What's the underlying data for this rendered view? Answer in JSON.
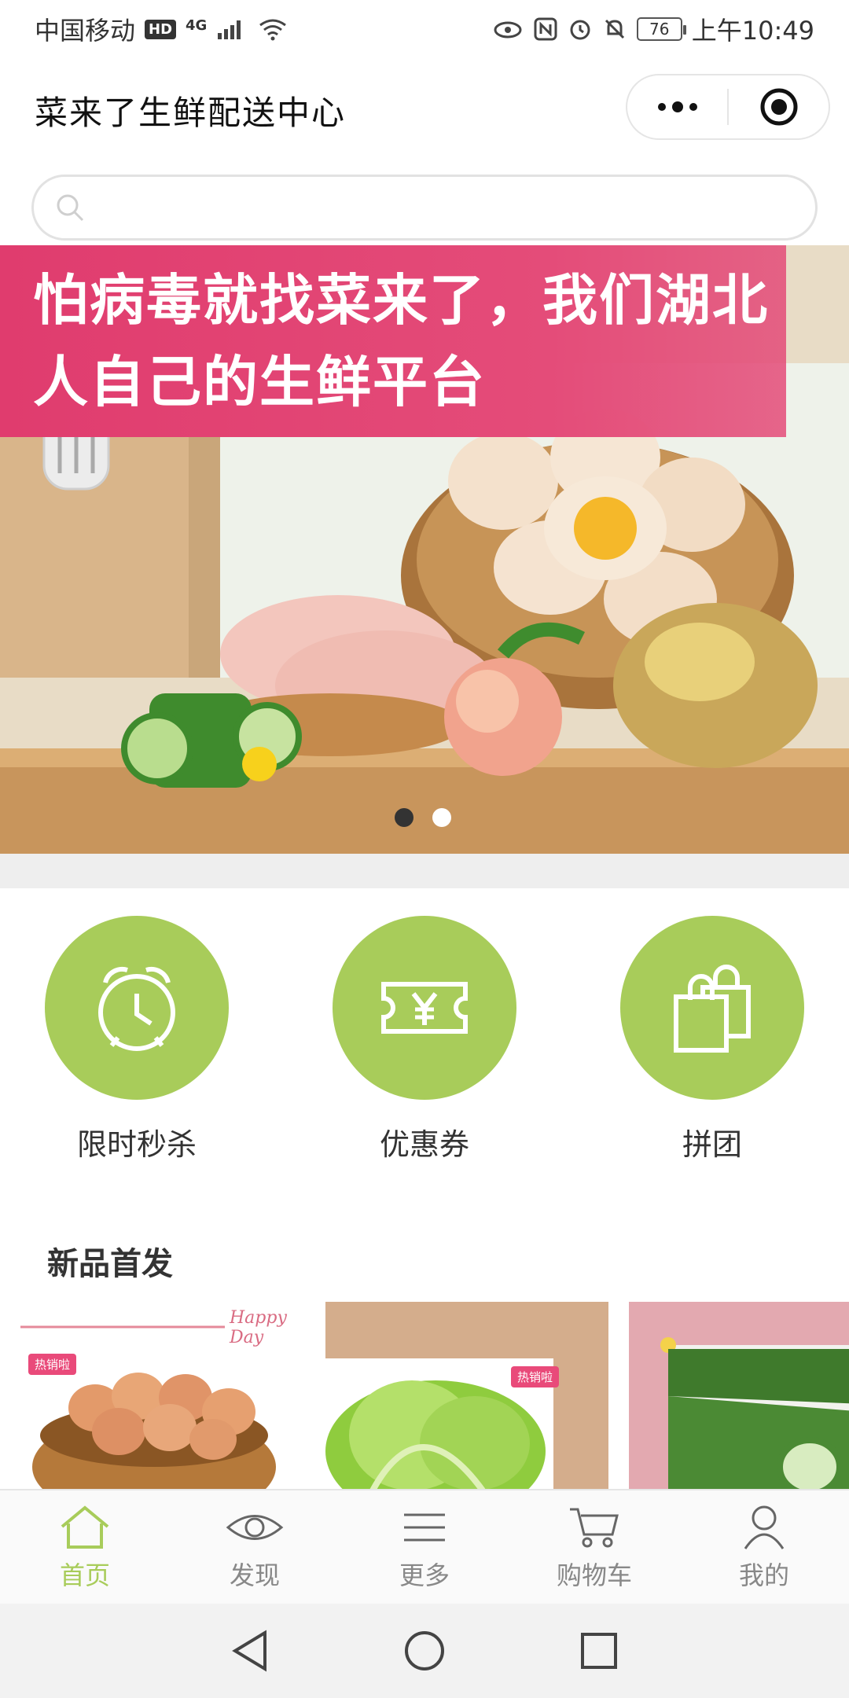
{
  "status_bar": {
    "carrier": "中国移动",
    "hd": "HD",
    "network": "4G",
    "battery": "76",
    "time": "上午10:49"
  },
  "header": {
    "title": "菜来了生鲜配送中心",
    "more_icon": "more-dots-icon",
    "close_icon": "target-circle-icon"
  },
  "search": {
    "placeholder": ""
  },
  "banner": {
    "text": "怕病毒就找菜来了，我们湖北人自己的生鲜平台",
    "slides": 2,
    "active_slide": 1,
    "colors": {
      "ribbon": "#e03c6e"
    }
  },
  "quick_actions": [
    {
      "label": "限时秒杀",
      "icon": "alarm-clock-icon"
    },
    {
      "label": "优惠券",
      "icon": "coupon-ticket-icon"
    },
    {
      "label": "拼团",
      "icon": "shopping-bags-icon"
    }
  ],
  "new_products": {
    "title": "新品首发",
    "items": [
      {
        "image": "eggs-basket",
        "tag": "热销啦",
        "banner_text": "Happy Day"
      },
      {
        "image": "lettuce",
        "tag": "热销啦"
      },
      {
        "image": "luffa-vegetable"
      }
    ]
  },
  "tabbar": {
    "items": [
      {
        "label": "首页",
        "icon": "home-icon",
        "active": true
      },
      {
        "label": "发现",
        "icon": "eye-icon",
        "active": false
      },
      {
        "label": "更多",
        "icon": "menu-lines-icon",
        "active": false
      },
      {
        "label": "购物车",
        "icon": "cart-icon",
        "active": false
      },
      {
        "label": "我的",
        "icon": "user-icon",
        "active": false
      }
    ],
    "active_color": "#a8cc5a",
    "inactive_color": "#888888"
  },
  "theme": {
    "accent": "#a8cc5a"
  }
}
